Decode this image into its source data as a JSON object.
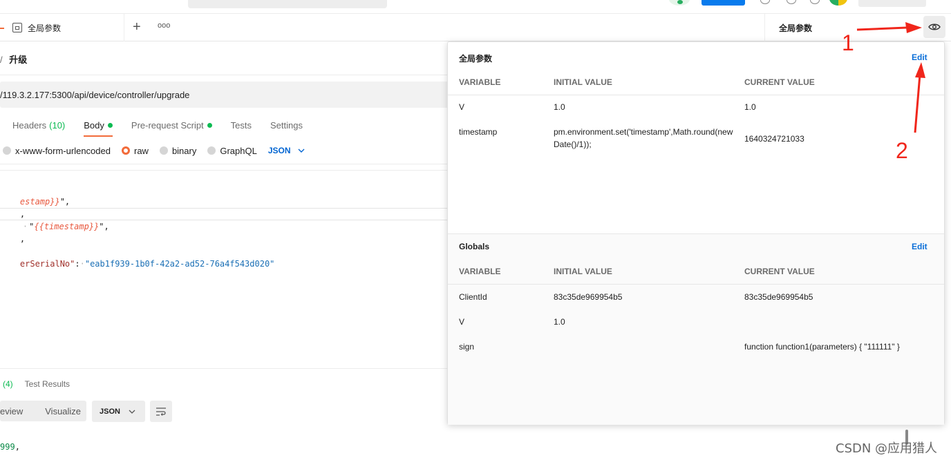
{
  "tabs": {
    "active_tab_label": "全局参数",
    "plus_glyph": "+",
    "more_glyph": "ooo"
  },
  "env_selector": {
    "label": "全局参数"
  },
  "request": {
    "breadcrumb_sep": "/",
    "name": "升级",
    "url": "/119.3.2.177:5300/api/device/controller/upgrade",
    "tabs": [
      {
        "label": "Headers",
        "count": "(10)"
      },
      {
        "label": "Body"
      },
      {
        "label": "Pre-request Script"
      },
      {
        "label": "Tests"
      },
      {
        "label": "Settings"
      }
    ],
    "body_options": {
      "urlencoded": "x-www-form-urlencoded",
      "raw": "raw",
      "binary": "binary",
      "graphql": "GraphQL",
      "language": "JSON"
    },
    "code_lines": {
      "l1_var": "estamp}}",
      "l1_tail": "\",",
      "l2": ",",
      "l3_ws": "·",
      "l3_open": "\"",
      "l3_var": "{{timestamp}}",
      "l3_close": "\",",
      "l4": ",",
      "l5_key": "erSerialNo\"",
      "l5_colon": ":",
      "l5_ws": "·",
      "l5_value": "\"eab1f939-1b0f-42a2-ad52-76a4f543d020\""
    }
  },
  "response": {
    "tests_count": "(4)",
    "test_results": "Test Results",
    "view_left": "eview",
    "visualize": "Visualize",
    "format": "JSON",
    "first_line_num": "999",
    "first_line_tail": ","
  },
  "env_popover": {
    "environment": {
      "title": "全局参数",
      "edit_label": "Edit",
      "columns": [
        "VARIABLE",
        "INITIAL VALUE",
        "CURRENT VALUE"
      ],
      "rows": [
        {
          "variable": "V",
          "initial": "1.0",
          "current": "1.0"
        },
        {
          "variable": "timestamp",
          "initial": "pm.environment.set('timestamp',Math.round(new Date()/1));",
          "current": "1640324721033"
        }
      ]
    },
    "globals": {
      "title": "Globals",
      "edit_label": "Edit",
      "columns": [
        "VARIABLE",
        "INITIAL VALUE",
        "CURRENT VALUE"
      ],
      "rows": [
        {
          "variable": "ClientId",
          "initial": "83c35de969954b5",
          "current": "83c35de969954b5"
        },
        {
          "variable": "V",
          "initial": "1.0",
          "current": ""
        },
        {
          "variable": "sign",
          "initial": "",
          "current": "function function1(parameters) { \"111111\" }"
        }
      ]
    }
  },
  "annotations": {
    "label_1": "1",
    "label_2": "2",
    "color": "#f0261b"
  },
  "watermark": "CSDN @应用猎人",
  "colors": {
    "accent_orange": "#f26b3a",
    "link_blue": "#0b6fd8",
    "status_green": "#0cbb52"
  }
}
